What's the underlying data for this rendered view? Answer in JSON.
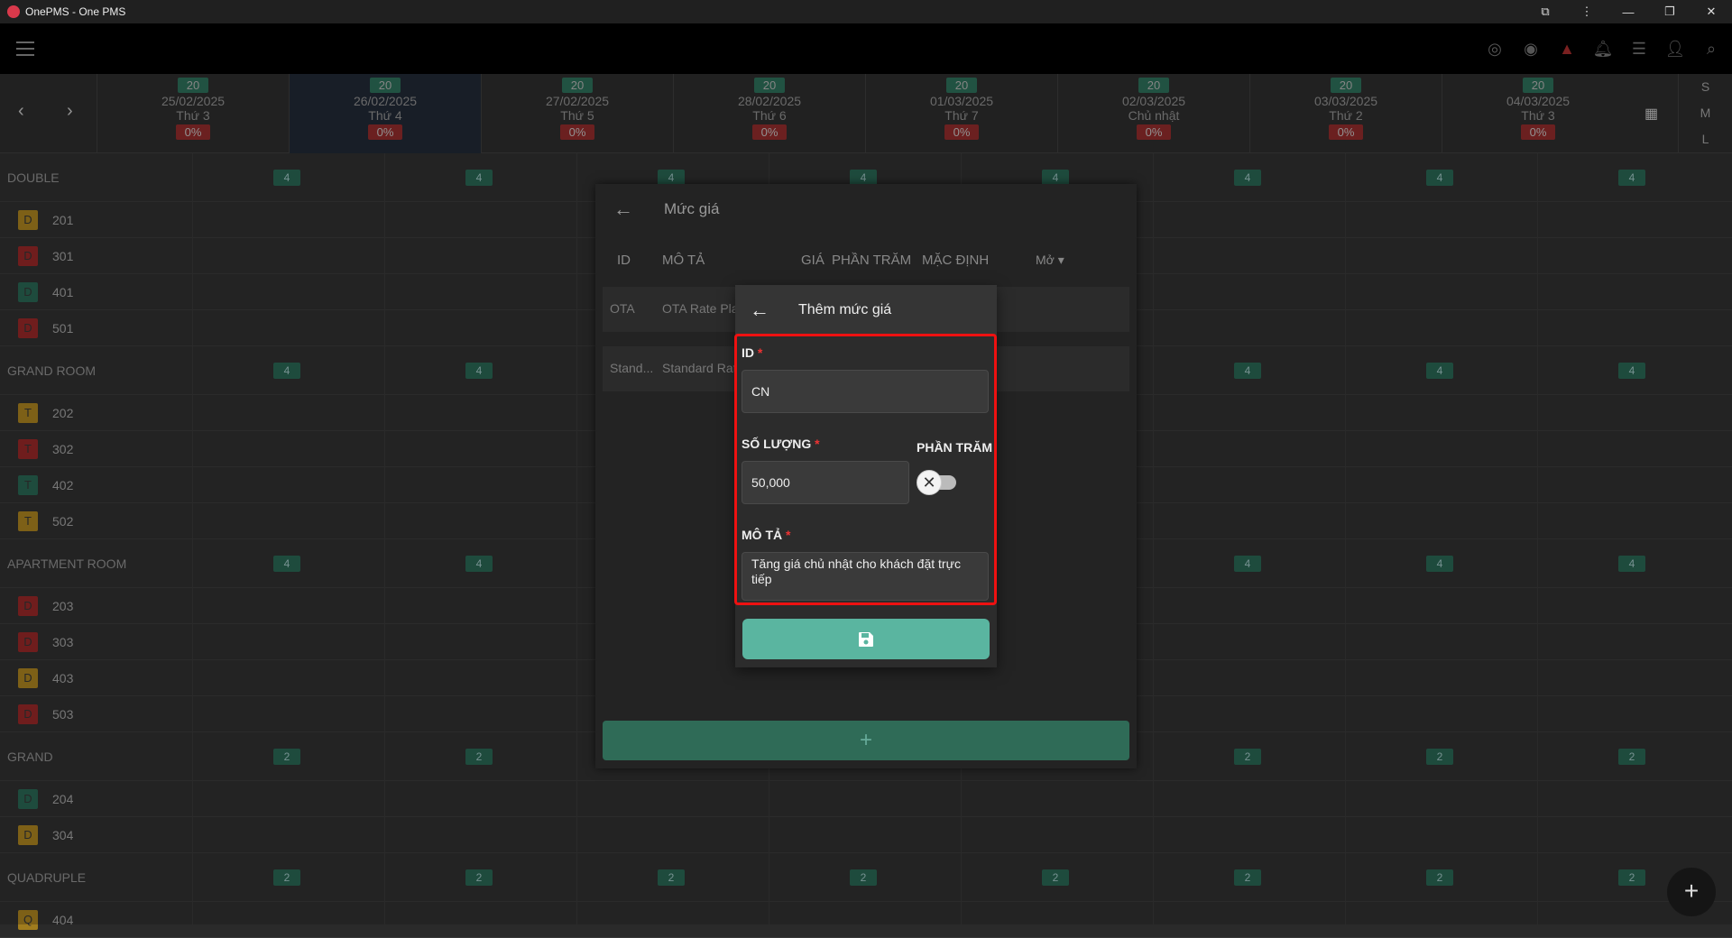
{
  "window": {
    "title": "OnePMS - One PMS"
  },
  "header": {
    "nav_prev": "‹",
    "nav_next": "›"
  },
  "dates": [
    {
      "count": "20",
      "date": "25/02/2025",
      "weekday": "Thứ 3",
      "pct": "0%"
    },
    {
      "count": "20",
      "date": "26/02/2025",
      "weekday": "Thứ 4",
      "pct": "0%",
      "selected": true
    },
    {
      "count": "20",
      "date": "27/02/2025",
      "weekday": "Thứ 5",
      "pct": "0%"
    },
    {
      "count": "20",
      "date": "28/02/2025",
      "weekday": "Thứ 6",
      "pct": "0%"
    },
    {
      "count": "20",
      "date": "01/03/2025",
      "weekday": "Thứ 7",
      "pct": "0%"
    },
    {
      "count": "20",
      "date": "02/03/2025",
      "weekday": "Chủ nhật",
      "pct": "0%"
    },
    {
      "count": "20",
      "date": "03/03/2025",
      "weekday": "Thứ 2",
      "pct": "0%"
    },
    {
      "count": "20",
      "date": "04/03/2025",
      "weekday": "Thứ 3",
      "pct": "0%"
    }
  ],
  "size_options": [
    "S",
    "M",
    "L"
  ],
  "groups": [
    {
      "name": "DOUBLE",
      "avail": "4",
      "rooms": [
        {
          "tag": "D",
          "num": "201",
          "color": "#a07c1e"
        },
        {
          "tag": "D",
          "num": "301",
          "color": "#8f2626"
        },
        {
          "tag": "D",
          "num": "401",
          "color": "#27614f"
        },
        {
          "tag": "D",
          "num": "501",
          "color": "#8f2626"
        }
      ]
    },
    {
      "name": "GRAND ROOM",
      "avail": "4",
      "rooms": [
        {
          "tag": "T",
          "num": "202",
          "color": "#a07c1e"
        },
        {
          "tag": "T",
          "num": "302",
          "color": "#8f2626"
        },
        {
          "tag": "T",
          "num": "402",
          "color": "#27614f"
        },
        {
          "tag": "T",
          "num": "502",
          "color": "#a07c1e"
        }
      ]
    },
    {
      "name": "APARTMENT ROOM",
      "avail": "4",
      "rooms": [
        {
          "tag": "D",
          "num": "203",
          "color": "#8f2626"
        },
        {
          "tag": "D",
          "num": "303",
          "color": "#8f2626"
        },
        {
          "tag": "D",
          "num": "403",
          "color": "#a07c1e"
        },
        {
          "tag": "D",
          "num": "503",
          "color": "#8f2626"
        }
      ]
    },
    {
      "name": "GRAND",
      "avail": "2",
      "rooms": [
        {
          "tag": "D",
          "num": "204",
          "color": "#27614f"
        },
        {
          "tag": "D",
          "num": "304",
          "color": "#a07c1e"
        }
      ]
    },
    {
      "name": "QUADRUPLE",
      "avail": "2",
      "rooms": [
        {
          "tag": "Q",
          "num": "404",
          "color": "#a07c1e"
        }
      ]
    }
  ],
  "rate_panel": {
    "title": "Mức giá",
    "columns": {
      "id": "ID",
      "desc": "MÔ TẢ",
      "price": "GIÁ",
      "percent": "PHẦN TRĂM",
      "default": "MẶC ĐỊNH",
      "status": "Mở"
    },
    "rows": [
      {
        "id": "OTA",
        "desc": "OTA Rate Plan"
      },
      {
        "id": "Stand...",
        "desc": "Standard Rate"
      }
    ],
    "add_label": "+"
  },
  "dialog": {
    "title": "Thêm mức giá",
    "id_label": "ID",
    "id_value": "CN",
    "qty_label": "SỐ LƯỢNG",
    "qty_value": "50,000",
    "percent_label": "PHẦN TRĂM",
    "percent_on": false,
    "desc_label": "MÔ TẢ",
    "desc_value": "Tăng giá chủ nhật cho khách đặt trực tiếp",
    "required_mark": "*"
  },
  "colors": {
    "accent": "#5ab5a0",
    "highlight": "#e11111",
    "badge": "#27614f"
  }
}
